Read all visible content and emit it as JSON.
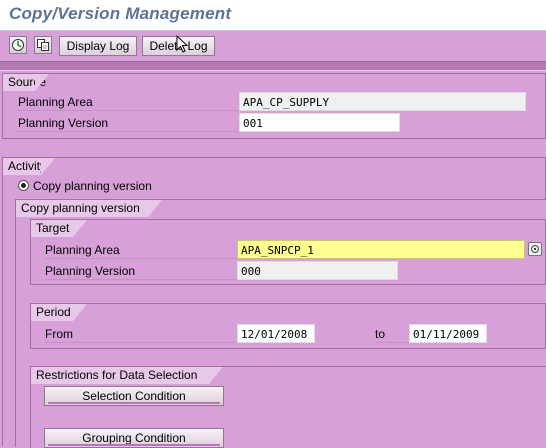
{
  "window": {
    "title": "Copy/Version Management"
  },
  "toolbar": {
    "execute_icon": "execute-icon",
    "copy_icon": "copy-icon",
    "display_log_label": "Display Log",
    "delete_log_label": "Delete Log"
  },
  "source": {
    "header": "Source",
    "planning_area_label": "Planning Area",
    "planning_area_value": "APA_CP_SUPPLY",
    "planning_version_label": "Planning Version",
    "planning_version_value": "001"
  },
  "activity": {
    "header": "Activity",
    "radio_label": "Copy planning version",
    "copy_header": "Copy planning version"
  },
  "target": {
    "header": "Target",
    "planning_area_label": "Planning Area",
    "planning_area_value": "APA_SNPCP_1",
    "planning_version_label": "Planning Version",
    "planning_version_value": "000"
  },
  "period": {
    "header": "Period",
    "from_label": "From",
    "from_value": "12/01/2008",
    "to_label": "to",
    "to_value": "01/11/2009"
  },
  "restrictions": {
    "header": "Restrictions for Data Selection",
    "selection_button": "Selection Condition",
    "grouping_button": "Grouping Condition"
  },
  "colors": {
    "background": "#d8a0d8",
    "title_text": "#5c7392",
    "required_field": "#ffff90"
  }
}
